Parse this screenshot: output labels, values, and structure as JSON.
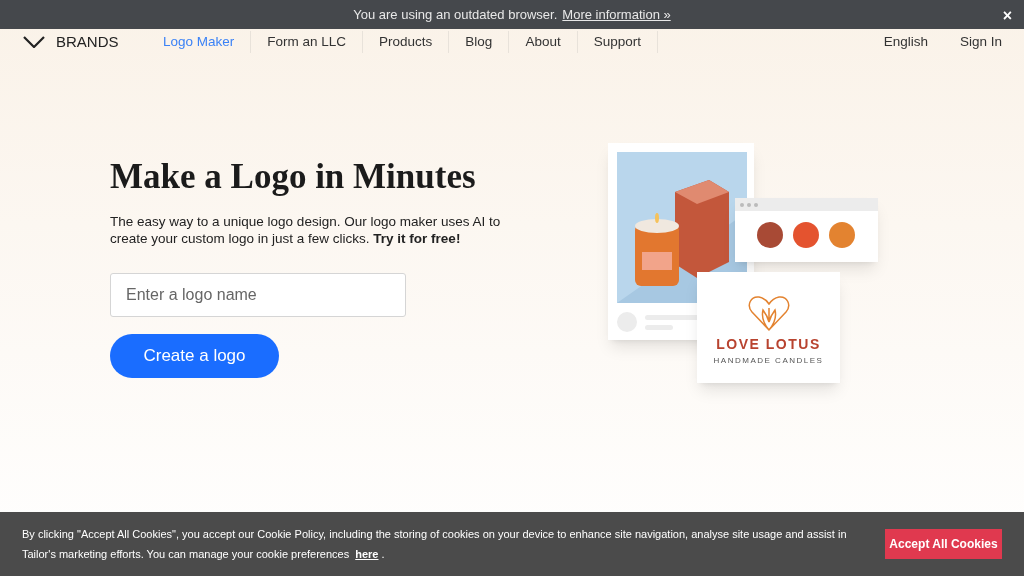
{
  "browser_banner": {
    "message": "You are using an outdated browser.",
    "link": "More information »",
    "close": "×"
  },
  "nav": {
    "brand": "BRANDS",
    "items": [
      {
        "label": "Logo Maker",
        "selected": true
      },
      {
        "label": "Form an LLC",
        "selected": false
      },
      {
        "label": "Products",
        "selected": false
      },
      {
        "label": "Blog",
        "selected": false
      },
      {
        "label": "About",
        "selected": false
      },
      {
        "label": "Support",
        "selected": false
      }
    ],
    "right": [
      "English",
      "Sign In"
    ]
  },
  "hero": {
    "title": "Make a Logo in Minutes",
    "description": "The easy way to a unique logo design. Our logo maker uses AI to create your custom logo in just a few clicks. **Try it for free!**",
    "input": {
      "placeholder": "Enter a logo name"
    },
    "button": "Create a logo"
  },
  "illustration": {
    "palette": [
      {
        "color": "#a84a35"
      },
      {
        "color": "#e4532f"
      },
      {
        "color": "#e38330"
      }
    ],
    "logo_name": "LOVE LOTUS",
    "logo_tagline": "HANDMADE CANDLES"
  },
  "cookie_bar": {
    "text_before": "By clicking \"Accept All Cookies\", you accept our Cookie Policy, including the storing of cookies on your device to enhance site navigation, analyse site usage and assist in Tailor's marketing efforts. You can manage your cookie preferences",
    "link": "here",
    "text_after": ".",
    "button": "Accept All Cookies"
  }
}
